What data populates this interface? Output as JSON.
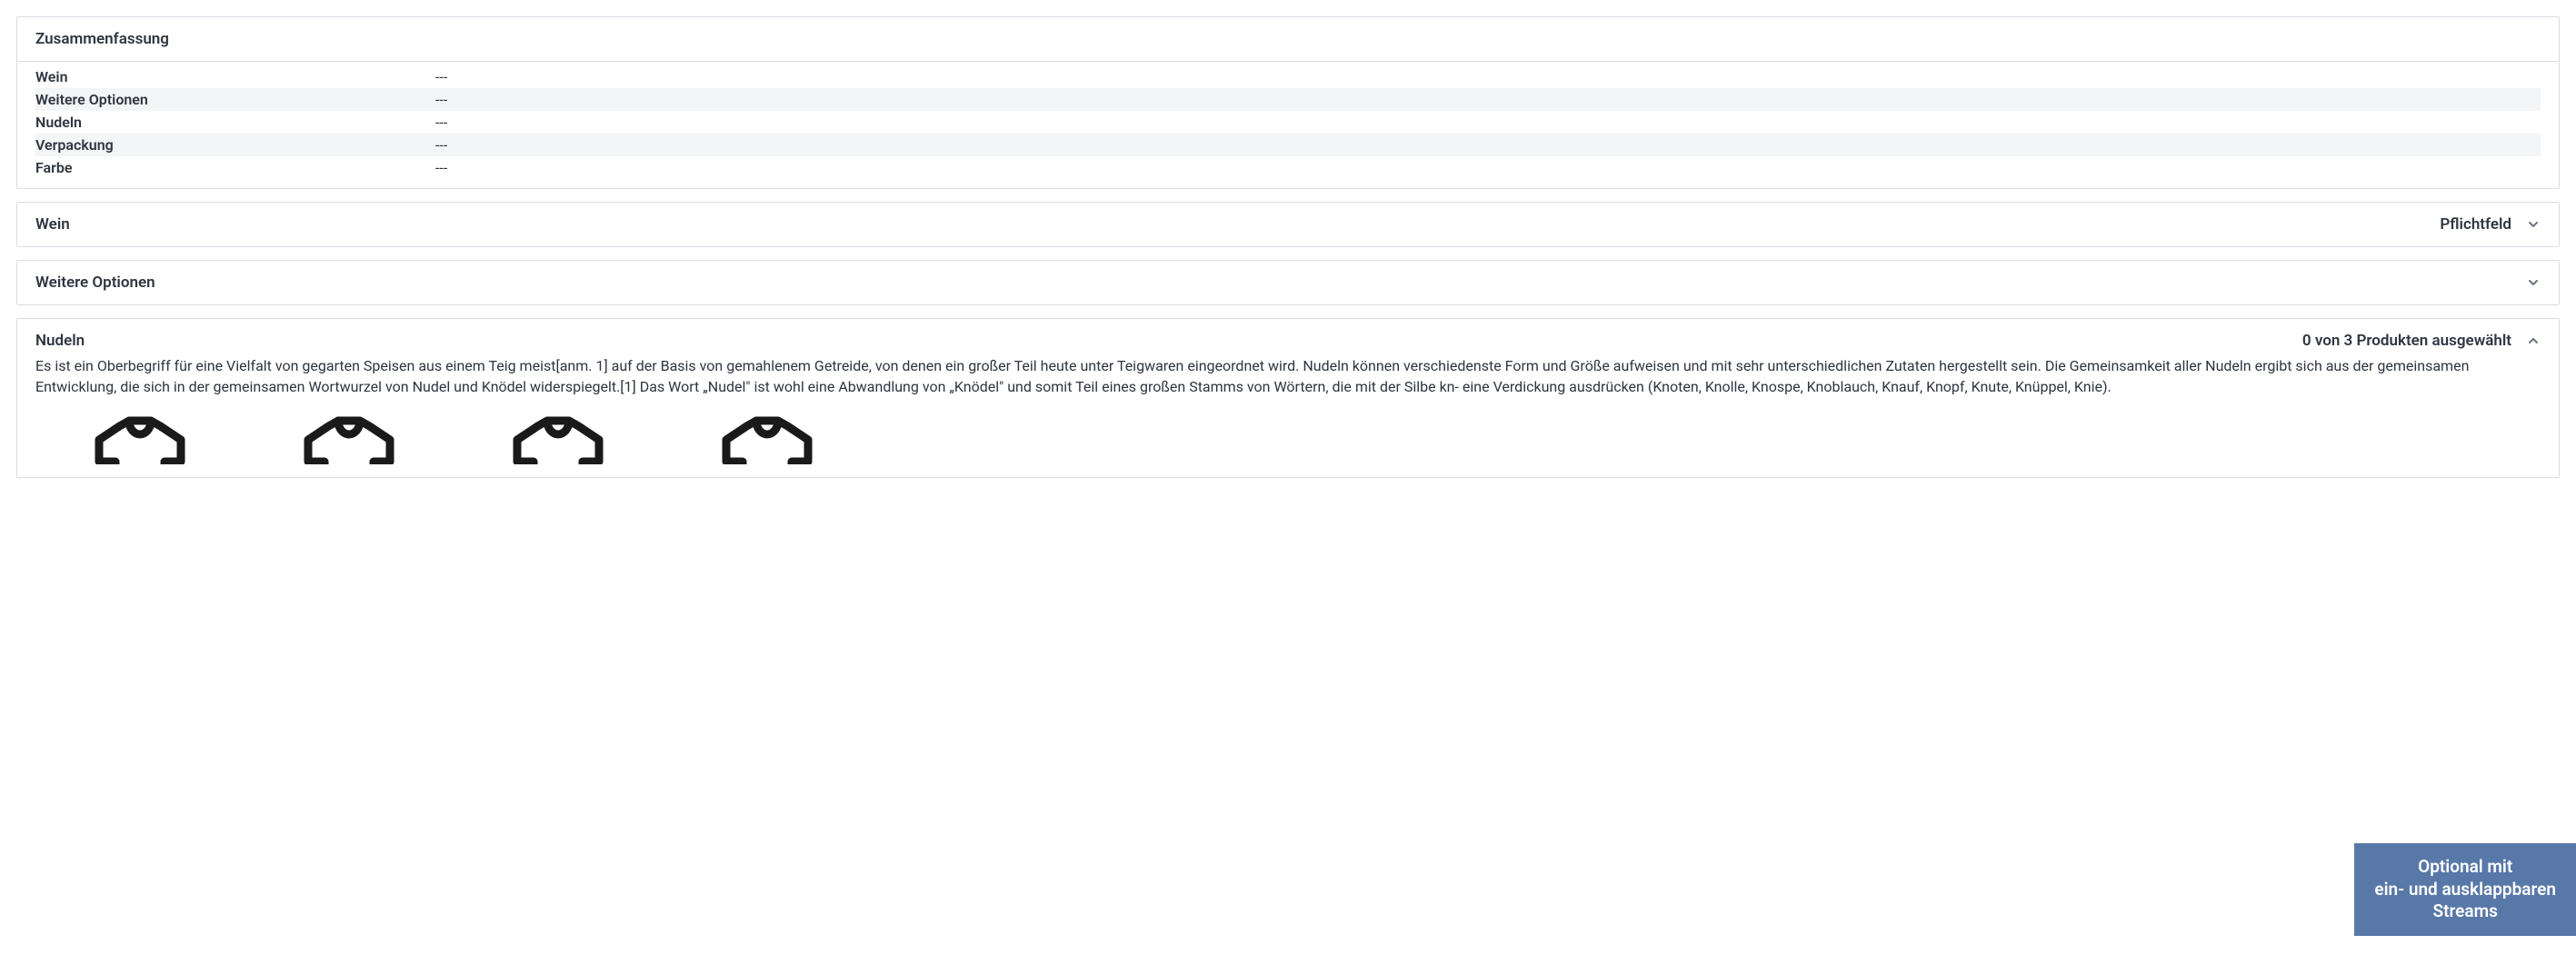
{
  "summary": {
    "title": "Zusammenfassung",
    "rows": [
      {
        "label": "Wein",
        "value": "---"
      },
      {
        "label": "Weitere Optionen",
        "value": "---"
      },
      {
        "label": "Nudeln",
        "value": "---"
      },
      {
        "label": "Verpackung",
        "value": "---"
      },
      {
        "label": "Farbe",
        "value": "---"
      }
    ]
  },
  "sections": {
    "wein": {
      "title": "Wein",
      "required_label": "Pflichtfeld"
    },
    "weitere": {
      "title": "Weitere Optionen"
    },
    "nudeln": {
      "title": "Nudeln",
      "count_label": "0 von 3 Produkten ausgewählt",
      "description": "Es ist ein Oberbegriff für eine Vielfalt von gegarten Speisen aus einem Teig meist[anm. 1] auf der Basis von gemahlenem Getreide, von denen ein großer Teil heute unter Teigwaren eingeordnet wird. Nudeln können verschiedenste Form und Größe aufweisen und mit sehr unterschiedlichen Zutaten hergestellt sein. Die Gemeinsamkeit aller Nudeln ergibt sich aus der gemeinsamen Entwicklung, die sich in der gemeinsamen Wortwurzel von Nudel und Knödel widerspiegelt.[1] Das Wort „Nudel\" ist wohl eine Abwandlung von „Knödel\" und somit Teil eines großen Stamms von Wörtern, die mit der Silbe kn- eine Verdickung ausdrücken (Knoten, Knolle, Knospe, Knoblauch, Knauf, Knopf, Knute, Knüppel, Knie)."
    }
  },
  "tooltip": {
    "line1": "Optional mit",
    "line2": "ein- und ausklappbaren",
    "line3": "Streams"
  }
}
